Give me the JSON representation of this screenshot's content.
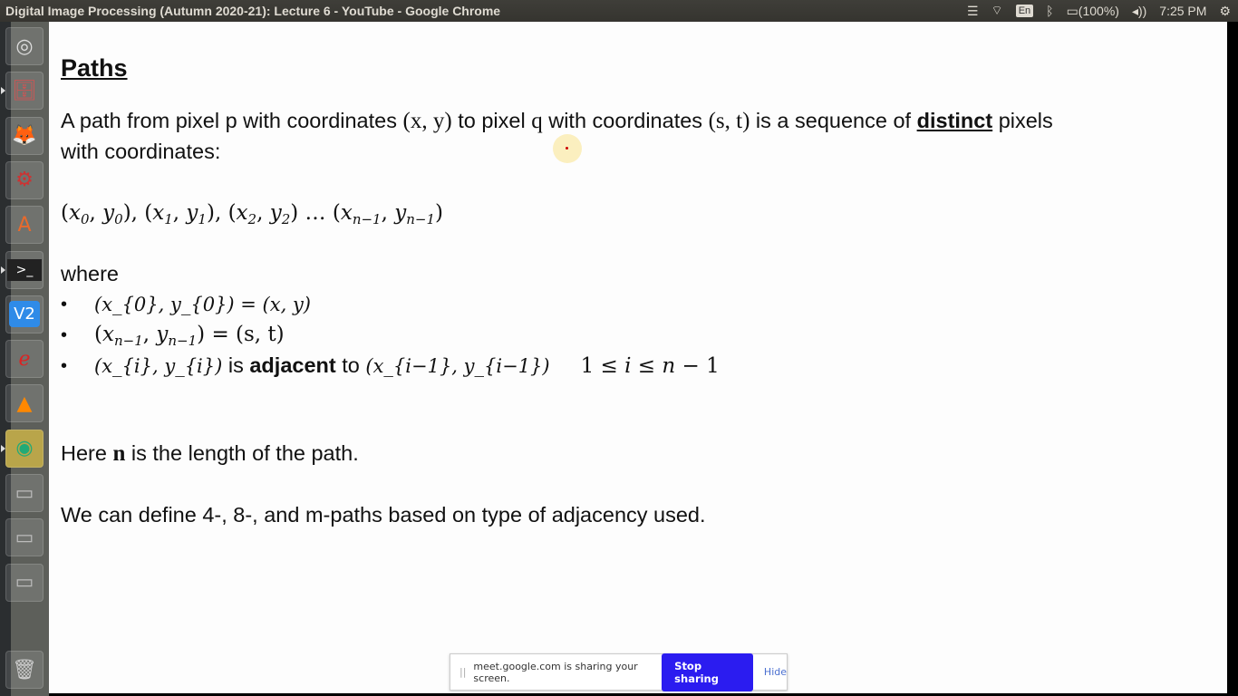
{
  "window": {
    "title": "Digital Image Processing (Autumn 2020-21): Lecture 6 - YouTube - Google Chrome"
  },
  "tray": {
    "keyboard": "En",
    "battery": "(100%)",
    "time": "7:25 PM",
    "icons": [
      "menu-list-icon",
      "wifi-icon",
      "keyboard-layout-icon",
      "bluetooth-icon",
      "battery-icon",
      "volume-icon",
      "power-gear-icon"
    ]
  },
  "launcher": [
    {
      "name": "ubuntu-dash",
      "glyph": "◎"
    },
    {
      "name": "files",
      "glyph": "🗄"
    },
    {
      "name": "firefox",
      "glyph": "🦊"
    },
    {
      "name": "system-settings",
      "glyph": "⚙"
    },
    {
      "name": "software-center",
      "glyph": "A"
    },
    {
      "name": "terminal",
      "glyph": ">_"
    },
    {
      "name": "vnc-viewer",
      "glyph": "V2"
    },
    {
      "name": "pdf-viewer",
      "glyph": "ℯ"
    },
    {
      "name": "vlc",
      "glyph": "▲"
    },
    {
      "name": "chrome",
      "glyph": "◉"
    },
    {
      "name": "drive-1",
      "glyph": "▭"
    },
    {
      "name": "drive-2",
      "glyph": "▭"
    },
    {
      "name": "drive-3",
      "glyph": "▭"
    },
    {
      "name": "trash",
      "glyph": "🗑"
    }
  ],
  "slide": {
    "heading": "Paths",
    "p1": {
      "a": "A path from pixel p with coordinates ",
      "b": "(x, y)",
      "c": " to pixel ",
      "d": "q",
      "e": " with coordinates ",
      "f": "(s, t)",
      "g": " is a sequence of ",
      "h": "distinct",
      "i": " pixels"
    },
    "p1_line2": "with coordinates:",
    "sequence": "(x_{0}, y_{0}), (x_{1}, y_{1}), (x_{2}, y_{2}) … (x_{n−1}, y_{n−1})",
    "where": "where",
    "bullets": [
      {
        "math": "(x_{0}, y_{0}) = (x, y)"
      },
      {
        "math": "(x_{n−1}, y_{n−1}) = (s, t)"
      },
      {
        "math": "(x_{i}, y_{i})",
        "mid1": " is ",
        "bold": "adjacent",
        "mid2": " to ",
        "math2": "(x_{i−1}, y_{i−1})",
        "cond": "1 ≤ i ≤ n − 1"
      }
    ],
    "here": {
      "a": "Here ",
      "n": "n",
      "b": " is the length of the path."
    },
    "last": "We can define 4-, 8-, and m-paths based on type of adjacency used."
  },
  "share_bar": {
    "message": "meet.google.com is sharing your screen.",
    "stop": "Stop sharing",
    "hide": "Hide",
    "accent": "#2b1cf0"
  }
}
